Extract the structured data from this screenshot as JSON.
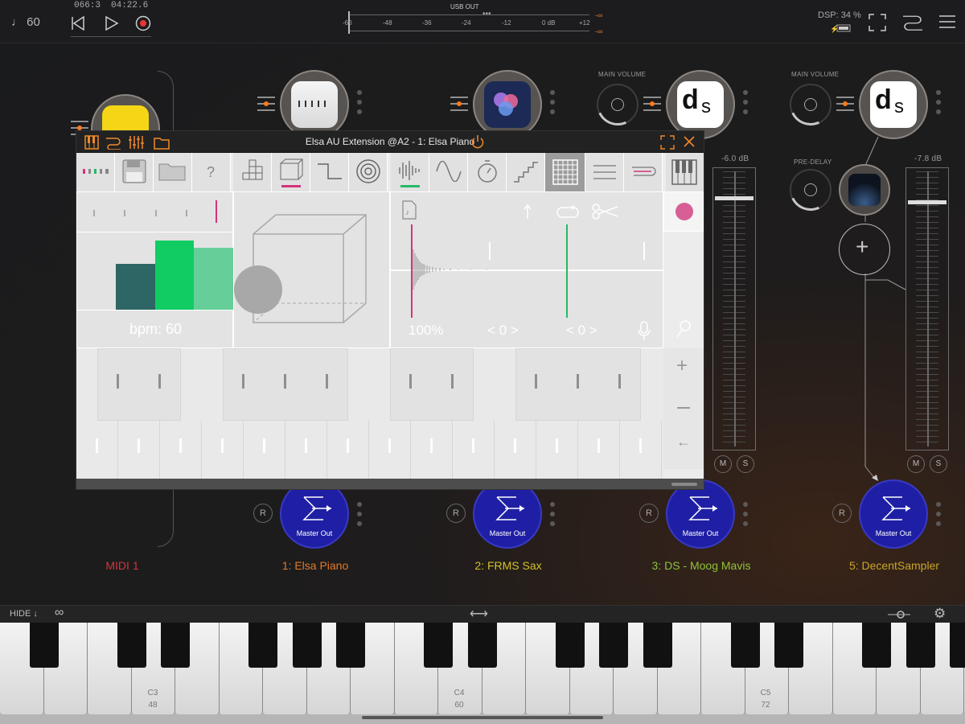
{
  "transport": {
    "tempo": "♩ 60",
    "bars_beats": "066:3",
    "time": "04:22.6"
  },
  "meter": {
    "label": "USB OUT",
    "scale": [
      "-60",
      "-48",
      "-36",
      "-24",
      "-12",
      "0 dB",
      "+12"
    ],
    "peak": "-∞"
  },
  "status": {
    "dsp": "DSP: 34 %"
  },
  "channels": [
    {
      "name": "MIDI 1",
      "color": "#d2353e"
    },
    {
      "name": "1: Elsa Piano",
      "color": "#e07a2a"
    },
    {
      "name": "2: FRMS Sax",
      "color": "#d3c02a"
    },
    {
      "name": "3: DS - Moog Mavis",
      "color": "#8fc23a"
    },
    {
      "name": "5: DecentSampler",
      "color": "#caa52a"
    }
  ],
  "strip3": {
    "main_volume": "MAIN VOLUME",
    "db": "-6.0 dB",
    "fader_level_db": -6.0,
    "mute": "M",
    "solo": "S"
  },
  "strip5": {
    "main_volume": "MAIN VOLUME",
    "pre_delay": "PRE-DELAY",
    "db": "-7.8 dB",
    "fader_level_db": -7.8,
    "mute": "M",
    "solo": "S"
  },
  "master_out": "Master Out",
  "record_btn": "R",
  "plugin": {
    "title": "Elsa AU Extension @A2 - 1: Elsa Piano",
    "help": "?",
    "bpm": "bpm: 60",
    "zoom": "100%",
    "shift1": "< 0 >",
    "shift2": "< 0 >"
  },
  "keyboard": {
    "hide": "HIDE ↓",
    "c3": "C3",
    "c3_num": "48",
    "c4": "C4",
    "c4_num": "60",
    "c5": "C5",
    "c5_num": "72"
  },
  "icons": [
    "metronome-note",
    "rewind-icon",
    "play-icon",
    "record-icon",
    "battery-icon",
    "fullscreen-icon",
    "routing-icon",
    "menu-icon",
    "piano-icon",
    "save-icon",
    "folder-icon",
    "settings-icon",
    "link-icon"
  ]
}
